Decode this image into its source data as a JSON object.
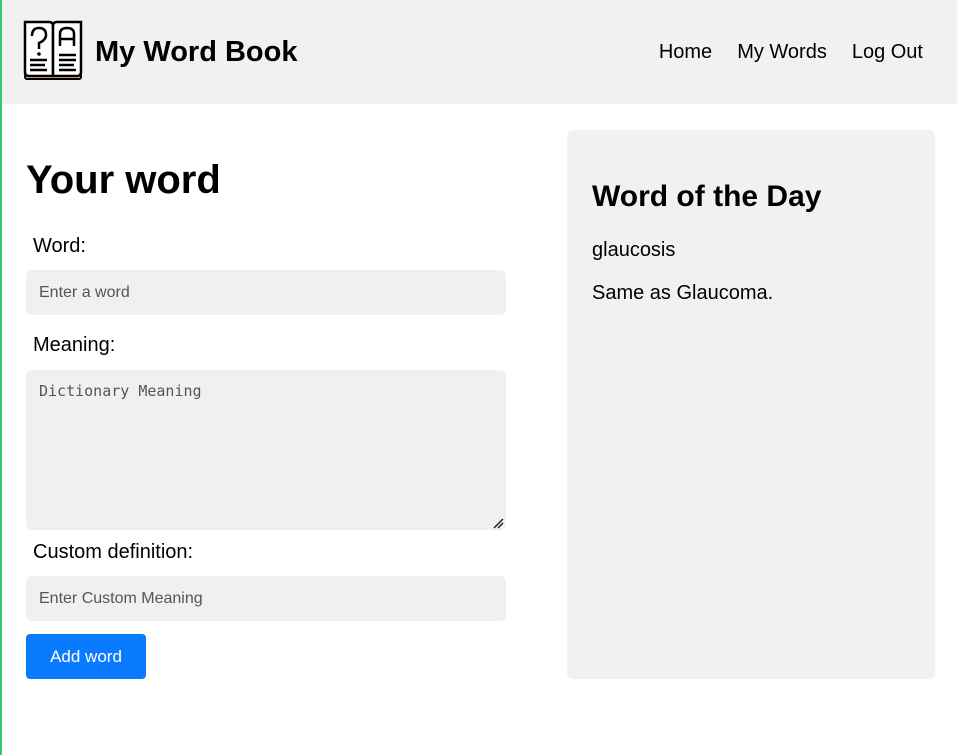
{
  "header": {
    "app_title": "My Word Book",
    "logo_icon": "open-book-icon",
    "nav": [
      {
        "label": "Home"
      },
      {
        "label": "My Words"
      },
      {
        "label": "Log Out"
      }
    ]
  },
  "form": {
    "title": "Your word",
    "word": {
      "label": "Word:",
      "value": "",
      "placeholder": "Enter a word"
    },
    "meaning": {
      "label": "Meaning:",
      "value": "",
      "placeholder": "Dictionary Meaning"
    },
    "custom": {
      "label": "Custom definition:",
      "value": "",
      "placeholder": "Enter Custom Meaning"
    },
    "submit_label": "Add word"
  },
  "word_of_the_day": {
    "heading": "Word of the Day",
    "word": "glaucosis",
    "meaning": "Same as Glaucoma."
  },
  "colors": {
    "header_bg": "#f1f1f1",
    "field_bg": "#f0f0f0",
    "button_bg": "#0a7bff",
    "left_accent": "#2ecc71"
  }
}
